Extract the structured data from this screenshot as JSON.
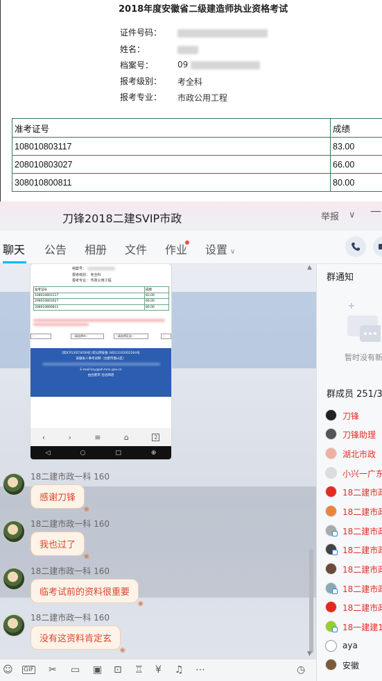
{
  "certificate": {
    "title": "2018年度安徽省二级建造师执业资格考试",
    "fields": [
      {
        "label": "证件号码：",
        "value": ""
      },
      {
        "label": "姓名：",
        "value": ""
      },
      {
        "label": "档案号：",
        "value": "09"
      },
      {
        "label": "报考级别：",
        "value": "考全科"
      },
      {
        "label": "报考专业：",
        "value": "市政公用工程"
      }
    ],
    "table_headers": [
      "准考证号",
      "成绩"
    ],
    "rows": [
      [
        "108010803117",
        "83.00"
      ],
      [
        "208010803027",
        "66.00"
      ],
      [
        "308010800811",
        "80.00"
      ]
    ]
  },
  "window": {
    "title": "刀锋2018二建SVIP市政",
    "report_label": "举报",
    "chevron": "∨",
    "minimize": "—",
    "tabs": [
      "聊天",
      "公告",
      "相册",
      "文件",
      "作业",
      "设置"
    ],
    "active_tab": 0,
    "call_icon": "phone-icon",
    "video_icon": "video-icon"
  },
  "image_message": {
    "fields": [
      {
        "label": "档案号：",
        "value": ""
      },
      {
        "label": "报考级别：",
        "value": "考全科"
      },
      {
        "label": "报考专业：",
        "value": "市政公用工程"
      }
    ],
    "headers": [
      "准考证号",
      "成绩"
    ],
    "rows": [
      [
        "108010803117",
        "83.00"
      ],
      [
        "208010803027",
        "66.00"
      ],
      [
        "308010800811",
        "80.00"
      ]
    ],
    "select_1": "--请选择市--",
    "select_2": "--请选择区县--",
    "footer_line1": "[皖ICP13015656号] 皖公网安备 34011102002264号",
    "footer_line2": "安徽省人事考试网（合肥市蜀山区）",
    "footer_line3": "E-mail:ksy@ah.hrss.gov.cn",
    "footer_line4": "由合肥市 任达网谱"
  },
  "messages": [
    {
      "sender": "18二建市政一科 160",
      "text": "感谢刀锋"
    },
    {
      "sender": "18二建市政一科 160",
      "text": "我也过了"
    },
    {
      "sender": "18二建市政一科 160",
      "text": "临考试前的资料很重要"
    },
    {
      "sender": "18二建市政一科 160",
      "text": "没有这资料肯定玄"
    }
  ],
  "right_panel": {
    "notice_title": "群通知",
    "notice_empty": "暂时没有新",
    "members_title": "群成员 251/3",
    "members": [
      {
        "name": "刀锋",
        "color": "#e0302a"
      },
      {
        "name": "刀锋助理",
        "color": "#e0302a"
      },
      {
        "name": "湖北市政",
        "color": "#e0302a"
      },
      {
        "name": "小兴一广东",
        "color": "#e0302a"
      },
      {
        "name": "18二建市政",
        "color": "#e0302a"
      },
      {
        "name": "18二建市政",
        "color": "#e0302a"
      },
      {
        "name": "18二建市政",
        "color": "#e0302a"
      },
      {
        "name": "18二建市政",
        "color": "#e0302a"
      },
      {
        "name": "18二建市政",
        "color": "#e0302a"
      },
      {
        "name": "18二建市政",
        "color": "#e0302a"
      },
      {
        "name": "18二建市政",
        "color": "#e0302a"
      },
      {
        "name": "18一建建1",
        "color": "#e0302a"
      },
      {
        "name": "aya",
        "color": "#222222"
      },
      {
        "name": "安徽",
        "color": "#222222"
      }
    ]
  },
  "composer": {
    "tools": [
      "emoji-icon",
      "gif-icon",
      "scissors-icon",
      "folder-icon",
      "image-icon",
      "shake-icon",
      "gift-icon",
      "red-packet-icon",
      "bell-icon",
      "more-icon"
    ],
    "gif_label": "GIF",
    "history_icon": "clock-icon"
  }
}
